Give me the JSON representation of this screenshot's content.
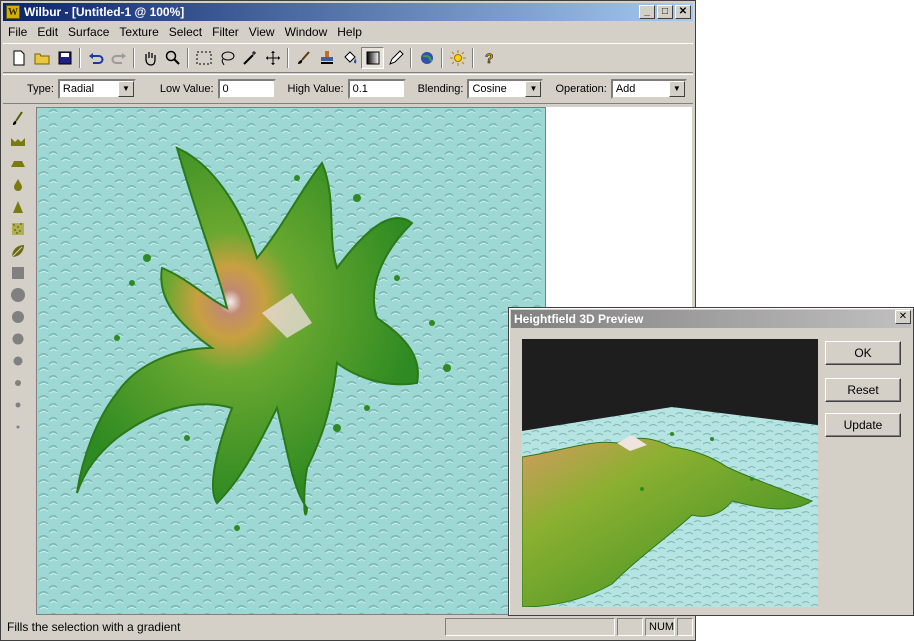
{
  "window": {
    "title": "Wilbur - [Untitled-1 @ 100%]",
    "app_icon": "W",
    "controls": {
      "minimize": "_",
      "maximize": "□",
      "close": "✕"
    }
  },
  "menu": [
    "File",
    "Edit",
    "Surface",
    "Texture",
    "Select",
    "Filter",
    "View",
    "Window",
    "Help"
  ],
  "options": {
    "type_label": "Type:",
    "type_value": "Radial",
    "low_label": "Low Value:",
    "low_value": "0",
    "high_label": "High Value:",
    "high_value": "0.1",
    "blending_label": "Blending:",
    "blending_value": "Cosine",
    "operation_label": "Operation:",
    "operation_value": "Add"
  },
  "status": {
    "message": "Fills the selection with a gradient",
    "num": "NUM"
  },
  "preview_dialog": {
    "title": "Heightfield 3D Preview",
    "close": "✕",
    "ok_label": "OK",
    "reset_label": "Reset",
    "update_label": "Update"
  },
  "colors": {
    "water": "#9ed8d4",
    "land": "#3e8f1e",
    "peak": "#c8906a",
    "title_active": "#0a246a",
    "title_inactive": "#808080"
  }
}
